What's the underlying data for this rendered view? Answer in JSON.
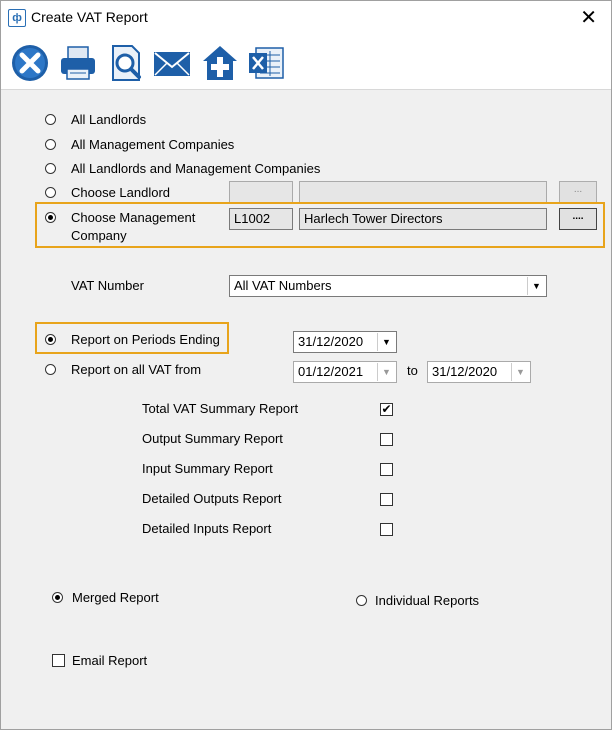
{
  "window": {
    "title": "Create VAT Report",
    "close_glyph": "✕",
    "app_icon_glyph": "ф"
  },
  "toolbar": [
    {
      "name": "close-report-icon"
    },
    {
      "name": "print-icon"
    },
    {
      "name": "preview-icon"
    },
    {
      "name": "email-icon"
    },
    {
      "name": "export-icon"
    },
    {
      "name": "excel-icon"
    }
  ],
  "options": {
    "all_landlords": "All Landlords",
    "all_management_companies": "All Management Companies",
    "all_landlords_and_mc": "All Landlords and Management Companies",
    "choose_landlord": "Choose Landlord",
    "choose_mc_line1": "Choose Management",
    "choose_mc_line2": "Company",
    "selected": "choose_management_company"
  },
  "landlord": {
    "code": "",
    "name": "",
    "browse_label": "..."
  },
  "management_company": {
    "code": "L1002",
    "name": "Harlech Tower Directors",
    "browse_label": "...."
  },
  "vat_number": {
    "label": "VAT Number",
    "value": "All VAT Numbers"
  },
  "periods": {
    "report_on_periods_ending_label": "Report on Periods Ending",
    "periods_ending_date": "31/12/2020",
    "report_on_all_vat_label": "Report on all VAT from",
    "from_date": "01/12/2021",
    "to_label": "to",
    "to_date": "31/12/2020",
    "selected": "periods_ending"
  },
  "reports": [
    {
      "label": "Total VAT Summary Report",
      "checked": true
    },
    {
      "label": "Output Summary Report",
      "checked": false
    },
    {
      "label": "Input Summary Report",
      "checked": false
    },
    {
      "label": "Detailed Outputs Report",
      "checked": false
    },
    {
      "label": "Detailed Inputs Report",
      "checked": false
    }
  ],
  "check_glyph": "✔",
  "output": {
    "merged_label": "Merged Report",
    "individual_label": "Individual Reports",
    "selected": "merged"
  },
  "email": {
    "label": "Email Report",
    "checked": false
  },
  "colors": {
    "highlight": "#e8a41b",
    "icon_blue": "#1e5fa8"
  }
}
